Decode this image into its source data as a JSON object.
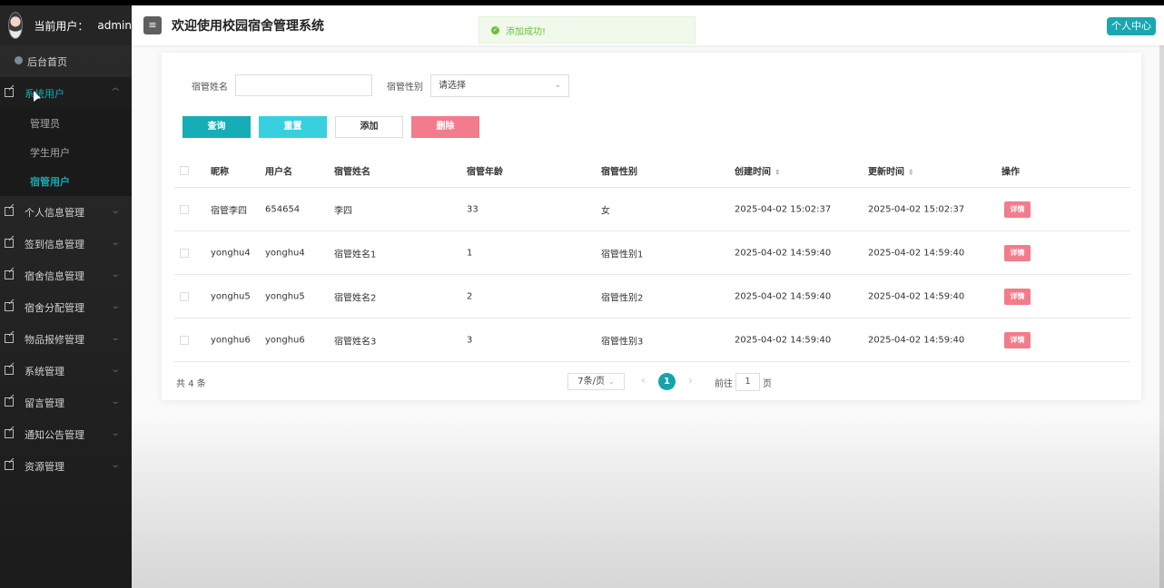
{
  "sidebar": {
    "user_label": "当前用户：",
    "user_name": "admin",
    "home": "后台首页",
    "menu_open": "系统用户",
    "sub_items": [
      "管理员",
      "学生用户",
      "宿管用户"
    ],
    "menus": [
      "个人信息管理",
      "签到信息管理",
      "宿舍信息管理",
      "宿舍分配管理",
      "物品报修管理",
      "系统管理",
      "留言管理",
      "通知公告管理",
      "资源管理"
    ]
  },
  "header": {
    "menu_icon": "hamburger-icon",
    "title": "欢迎使用校园宿舍管理系统",
    "toast": "添加成功!",
    "personal": "个人中心"
  },
  "search": {
    "name_label": "宿管姓名",
    "gender_label": "宿管性别",
    "gender_placeholder": "请选择"
  },
  "buttons": {
    "query": "查询",
    "reset": "重置",
    "add": "添加",
    "delete": "删除"
  },
  "table": {
    "headers": [
      "昵称",
      "用户名",
      "宿管姓名",
      "宿管年龄",
      "宿管性别",
      "创建时间",
      "更新时间",
      "操作"
    ],
    "rows": [
      [
        "宿管李四",
        "654654",
        "李四",
        "33",
        "女",
        "2025-04-02 15:02:37",
        "2025-04-02 15:02:37",
        "详情"
      ],
      [
        "yonghu4",
        "yonghu4",
        "宿管姓名1",
        "1",
        "宿管性别1",
        "2025-04-02 14:59:40",
        "2025-04-02 14:59:40",
        "详情"
      ],
      [
        "yonghu5",
        "yonghu5",
        "宿管姓名2",
        "2",
        "宿管性别2",
        "2025-04-02 14:59:40",
        "2025-04-02 14:59:40",
        "详情"
      ],
      [
        "yonghu6",
        "yonghu6",
        "宿管姓名3",
        "3",
        "宿管性别3",
        "2025-04-02 14:59:40",
        "2025-04-02 14:59:40",
        "详情"
      ]
    ]
  },
  "pagination": {
    "total": "共 4 条",
    "page_size": "7条/页",
    "current": "1",
    "goto_prefix": "前往",
    "goto_value": "1",
    "goto_suffix": "页"
  },
  "colors": {
    "accent": "#16adb7",
    "danger": "#f27c8b",
    "success": "#67c23a"
  }
}
